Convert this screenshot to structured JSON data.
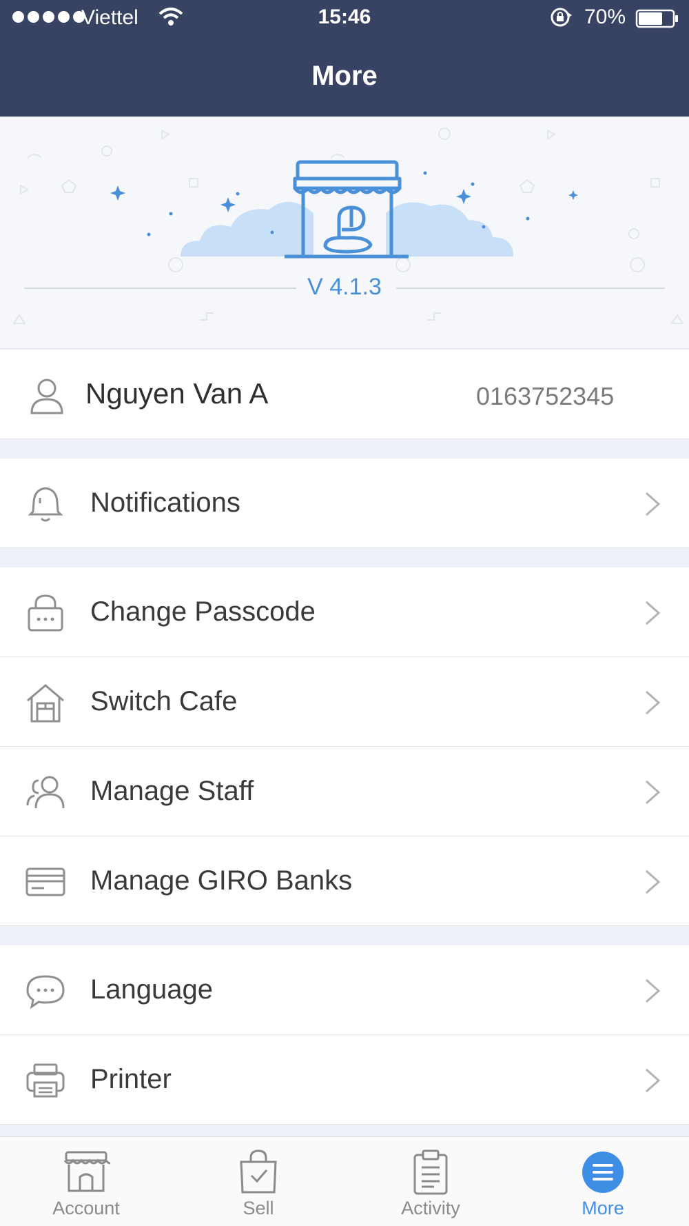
{
  "status_bar": {
    "carrier": "Viettel",
    "time": "15:46",
    "battery": "70%",
    "battery_level": 0.7
  },
  "nav": {
    "title": "More"
  },
  "banner": {
    "version": "V 4.1.3",
    "accent": "#4a90d9"
  },
  "profile": {
    "name": "Nguyen Van A",
    "phone": "0163752345"
  },
  "menu": [
    {
      "label": "Notifications",
      "icon": "bell-icon"
    },
    {
      "label": "Change Passcode",
      "icon": "lock-keypad-icon"
    },
    {
      "label": "Switch Cafe",
      "icon": "house-icon"
    },
    {
      "label": "Manage Staff",
      "icon": "people-icon"
    },
    {
      "label": "Manage GIRO Banks",
      "icon": "card-icon"
    },
    {
      "label": "Language",
      "icon": "chat-bubble-icon"
    },
    {
      "label": "Printer",
      "icon": "printer-icon"
    }
  ],
  "tabs": [
    {
      "label": "Account",
      "icon": "store-icon"
    },
    {
      "label": "Sell",
      "icon": "shopping-bag-icon"
    },
    {
      "label": "Activity",
      "icon": "clipboard-icon"
    },
    {
      "label": "More",
      "icon": "menu-icon",
      "active": true
    }
  ],
  "colors": {
    "header": "#384262",
    "active_tab": "#3f8ee6"
  }
}
